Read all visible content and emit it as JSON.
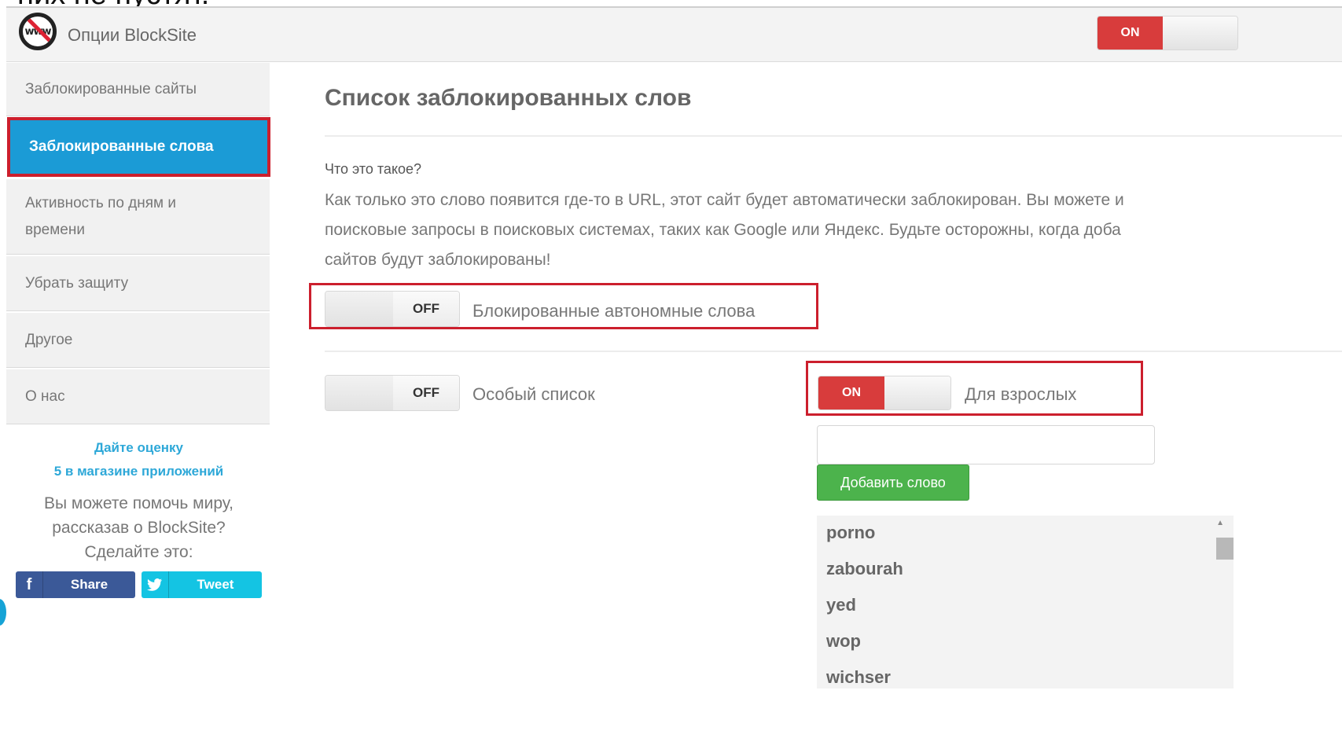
{
  "slide_top_text": "них не пустят.",
  "app": {
    "title": "Опции BlockSite",
    "master_switch": "ON"
  },
  "sidebar": {
    "items": [
      {
        "label": "Заблокированные сайты"
      },
      {
        "label": "Заблокированные слова"
      },
      {
        "label": "Активность по дням и времени"
      },
      {
        "label": "Убрать защиту"
      },
      {
        "label": "Другое"
      },
      {
        "label": "О нас"
      }
    ],
    "rate_line1": "Дайте оценку",
    "rate_line2": "5 в магазине приложений",
    "help_line1": "Вы можете помочь миру,",
    "help_line2": "рассказав о BlockSite?",
    "help_line3": "Сделайте это:",
    "share_label": "Share",
    "tweet_label": "Tweet"
  },
  "main": {
    "title": "Список заблокированных слов",
    "what_is": "Что это такое?",
    "desc_line1": "Как только это слово появится где-то в URL, этот сайт будет автоматически заблокирован. Вы можете и",
    "desc_line2": "поисковые запросы в поисковых системах, таких как Google или Яндекс. Будьте осторожны, когда доба",
    "desc_line3": "сайтов будут заблокированы!",
    "standalone": {
      "state": "OFF",
      "label": "Блокированные автономные слова"
    },
    "special": {
      "state": "OFF",
      "label": "Особый список"
    },
    "adult": {
      "state": "ON",
      "label": "Для взрослых"
    },
    "input_value": "",
    "add_button": "Добавить слово",
    "words": [
      "porno",
      "zabourah",
      "yed",
      "wop",
      "wichser"
    ]
  },
  "colors": {
    "accent_blue": "#1b9bd6",
    "switch_on_red": "#d83c3c",
    "highlight_red": "#cc1f2d",
    "add_green": "#4cb34c",
    "facebook": "#3b5998",
    "twitter": "#14c4e3"
  },
  "icons": {
    "logo": "www-blocked-icon",
    "share": "facebook-icon",
    "tweet": "twitter-bird-icon"
  }
}
